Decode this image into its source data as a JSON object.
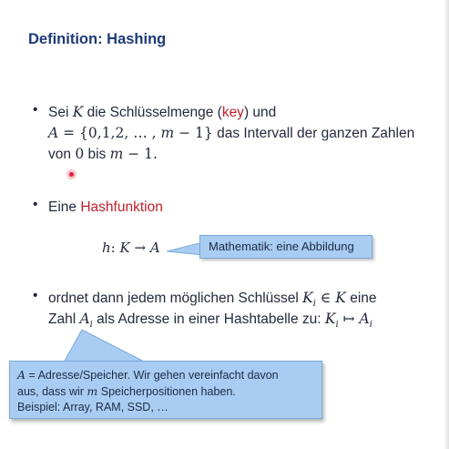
{
  "slide": {
    "title": "Definition: Hashing",
    "bullet_symbol": "•",
    "bullet1": {
      "line1_a": "Sei ",
      "line1_K": "K",
      "line1_b": " die Schlüsselmenge (",
      "line1_key": "key",
      "line1_c": ") und",
      "line2_A": "A",
      "line2_set": " = {0,1,2, … , ",
      "line2_m": "m",
      "line2_set_end": " − 1}",
      "line2_b": " das Intervall der ganzen Zahlen",
      "line3_a": "von ",
      "line3_zero": "0",
      "line3_b": " bis ",
      "line3_m": "m",
      "line3_end": " − 1."
    },
    "bullet2": {
      "text_a": "Eine ",
      "highlight": "Hashfunktion"
    },
    "formula": {
      "h": "h",
      "colon": ": ",
      "K": "K",
      "arrow": " → ",
      "A": "A"
    },
    "callout_math": "Mathematik: eine Abbildung",
    "bullet3": {
      "line1_a": "ordnet dann jedem möglichen Schlüssel ",
      "line1_Ki": "K",
      "line1_i": "i",
      "line1_in": " ∈ ",
      "line1_K": "K",
      "line1_b": " eine",
      "line2_a": "Zahl ",
      "line2_Ai": "A",
      "line2_i": "i",
      "line2_b": " als Adresse in einer Hashtabelle zu: ",
      "line2_Ki": "K",
      "line2_i2": "i",
      "line2_maps": " ↦ ",
      "line2_Ai2": "A",
      "line2_i3": "i"
    },
    "callout_address": {
      "line1_A": "A",
      "line1_rest": " = Adresse/Speicher. Wir gehen vereinfacht davon",
      "line2_a": "aus, dass wir ",
      "line2_m": "m",
      "line2_b": " Speicherpositionen haben.",
      "line3": "Beispiel: Array, RAM, SSD, …"
    },
    "colors": {
      "title": "#1d3a78",
      "highlight": "#c0202a",
      "callout_fill": "#a9cdf2",
      "callout_border": "#7aa9d9"
    }
  }
}
